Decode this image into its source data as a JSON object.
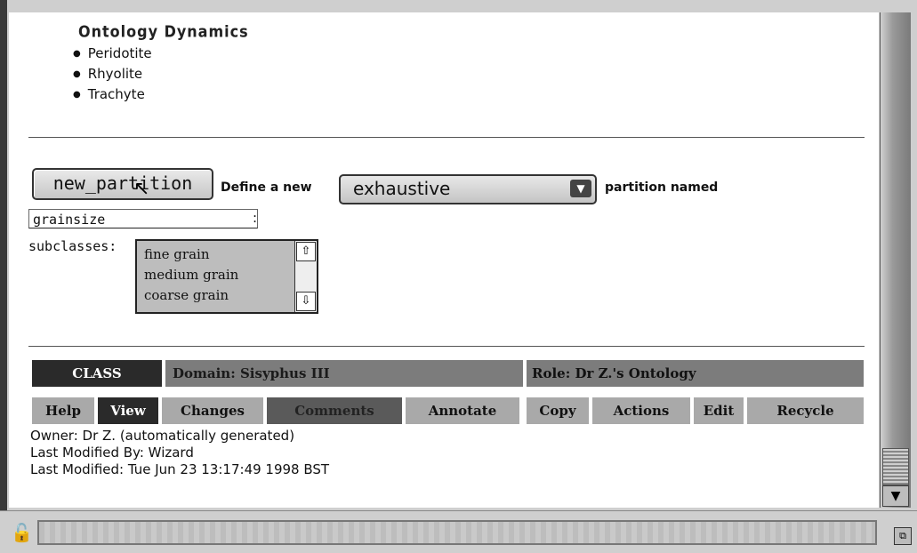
{
  "logo": {
    "text": "Ontology Dynamics"
  },
  "rock_list": [
    "Peridotite",
    "Rhyolite",
    "Trachyte"
  ],
  "form": {
    "new_partition_label": "new_partition",
    "define_label": "Define a new",
    "partition_type": "exhaustive",
    "partition_named_label": "partition named",
    "name_value": "grainsize",
    "colon": ":",
    "subclasses_label": "subclasses:",
    "subclasses": [
      "fine grain",
      "medium grain",
      "coarse grain"
    ]
  },
  "bars": {
    "class_label": "CLASS",
    "domain_label": "Domain: Sisyphus III",
    "role_label": "Role: Dr Z.'s Ontology"
  },
  "tabs": [
    "Help",
    "View",
    "Changes",
    "Comments",
    "Annotate",
    "Copy",
    "Actions",
    "Edit",
    "Recycle"
  ],
  "meta": {
    "owner": "Owner: Dr Z. (automatically generated)",
    "modified_by": "Last Modified By: Wizard",
    "modified": "Last Modified: Tue Jun 23 13:17:49 1998 BST"
  },
  "icons": {
    "lock": "lock-icon",
    "scroll_down": "arrow-down-icon",
    "resize": "resize-icon",
    "dropdown": "chevron-down-icon",
    "list_up": "arrow-up-icon",
    "list_down": "arrow-down-icon",
    "cursor": "mouse-pointer-icon"
  },
  "colors": {
    "class_bar": "#2a2a2a",
    "domain_bar": "#7c7c7c",
    "tab": "#a9a9a9"
  }
}
